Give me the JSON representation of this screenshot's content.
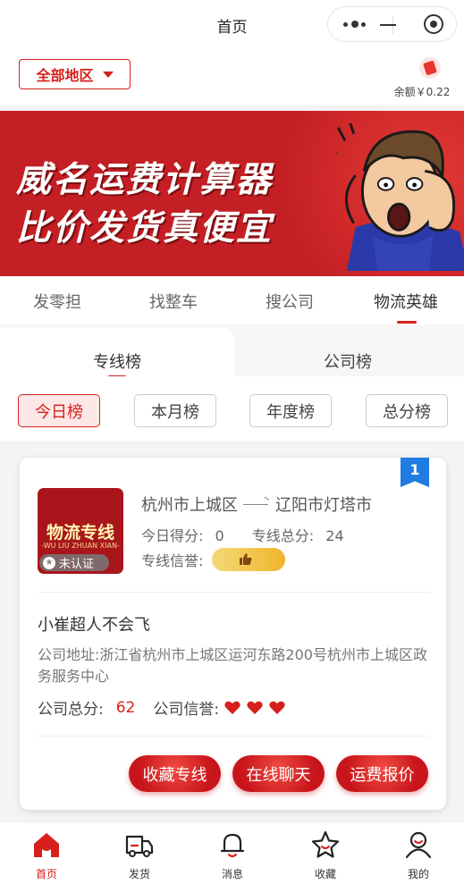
{
  "titlebar": {
    "title": "首页"
  },
  "header": {
    "region_label": "全部地区",
    "balance": "余额￥0.22"
  },
  "banner": {
    "line1": "威名运费计算器",
    "line2": "比价发货真便宜"
  },
  "tabs": [
    {
      "label": "发零担",
      "active": false
    },
    {
      "label": "找整车",
      "active": false
    },
    {
      "label": "搜公司",
      "active": false
    },
    {
      "label": "物流英雄",
      "active": true
    }
  ],
  "subtabs": [
    {
      "label": "专线榜",
      "active": true
    },
    {
      "label": "公司榜",
      "active": false
    }
  ],
  "chips": [
    {
      "label": "今日榜",
      "active": true
    },
    {
      "label": "本月榜",
      "active": false
    },
    {
      "label": "年度榜",
      "active": false
    },
    {
      "label": "总分榜",
      "active": false
    }
  ],
  "card": {
    "rank": "1",
    "logo_title": "物流专线",
    "logo_sub": "-WU LIU ZHUAN XIAN-",
    "verify_status": "未认证",
    "route_from": "杭州市上城区",
    "route_to": "辽阳市灯塔市",
    "today_score_label": "今日得分:",
    "today_score": "0",
    "line_total_label": "专线总分:",
    "line_total": "24",
    "line_credit_label": "专线信誉:",
    "company_name": "小崔超人不会飞",
    "address_label": "公司地址:",
    "address": "浙江省杭州市上城区运河东路200号杭州市上城区政务服务中心",
    "company_total_label": "公司总分:",
    "company_total": "62",
    "company_credit_label": "公司信誉:",
    "company_credit_hearts": 3,
    "buttons": {
      "favorite": "收藏专线",
      "chat": "在线聊天",
      "quote": "运费报价"
    }
  },
  "bottom_nav": [
    {
      "label": "首页",
      "icon": "home-icon",
      "active": true
    },
    {
      "label": "发货",
      "icon": "truck-icon",
      "active": false
    },
    {
      "label": "消息",
      "icon": "bell-icon",
      "active": false
    },
    {
      "label": "收藏",
      "icon": "star-icon",
      "active": false
    },
    {
      "label": "我的",
      "icon": "user-icon",
      "active": false
    }
  ],
  "colors": {
    "accent": "#d7201b",
    "badge_blue": "#1f7ce0",
    "banner_red": "#c41f24"
  }
}
